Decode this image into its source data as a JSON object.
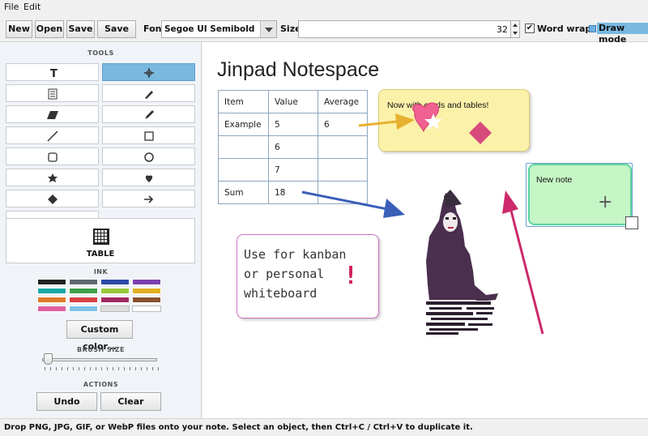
{
  "menu": [
    "File",
    "Edit"
  ],
  "toolbar": {
    "new": "New",
    "open": "Open",
    "save": "Save",
    "save_as": "Save as",
    "font_label": "Font",
    "font_value": "Segoe UI Semibold",
    "size_label": "Size",
    "size_value": "32",
    "word_wrap": "Word wrap",
    "word_wrap_checked": true,
    "draw_mode": "Draw mode",
    "draw_mode_checked": true
  },
  "sidebar": {
    "tools_header": "TOOLS",
    "tools": [
      "text-icon",
      "move-icon",
      "list-icon",
      "highlighter-icon",
      "parallelogram-icon",
      "pen-icon",
      "line-icon",
      "rectangle-icon",
      "rounded-rect-icon",
      "circle-icon",
      "star-icon",
      "heart-icon",
      "diamond-icon",
      "arrow-icon",
      "cloud-icon"
    ],
    "selected_tool": "move-icon",
    "table_label": "TABLE",
    "ink_header": "INK",
    "ink_colors": [
      "#222222",
      "#606870",
      "#2b4aa8",
      "#7b3fb0",
      "#1aa8a8",
      "#3fa04a",
      "#96c83c",
      "#e0b020",
      "#e07a2a",
      "#d84040",
      "#a02860",
      "#8a5030",
      "#e060a0",
      "#80c0e8",
      "#dddddd",
      "#ffffff"
    ],
    "custom_color": "Custom color...",
    "brush_header": "BRUSH SIZE",
    "brush_level": 0.05,
    "actions_header": "ACTIONS",
    "undo": "Undo",
    "clear": "Clear"
  },
  "canvas": {
    "title": "Jinpad Notespace",
    "table": {
      "headers": [
        "Item",
        "Value",
        "Average"
      ],
      "rows": [
        [
          "Example",
          "5",
          "6"
        ],
        [
          "",
          "6",
          ""
        ],
        [
          "",
          "7",
          ""
        ],
        [
          "Sum",
          "18",
          ""
        ]
      ]
    },
    "card_yellow": "Now with cards and tables!",
    "card_green": "New note",
    "card_pink": [
      "Use for kanban",
      "or personal",
      "whiteboard"
    ],
    "card_pink_mark": "!"
  },
  "status": "Drop PNG, JPG, GIF, or WebP files onto your note. Select an object, then Ctrl+C / Ctrl+V to duplicate it."
}
